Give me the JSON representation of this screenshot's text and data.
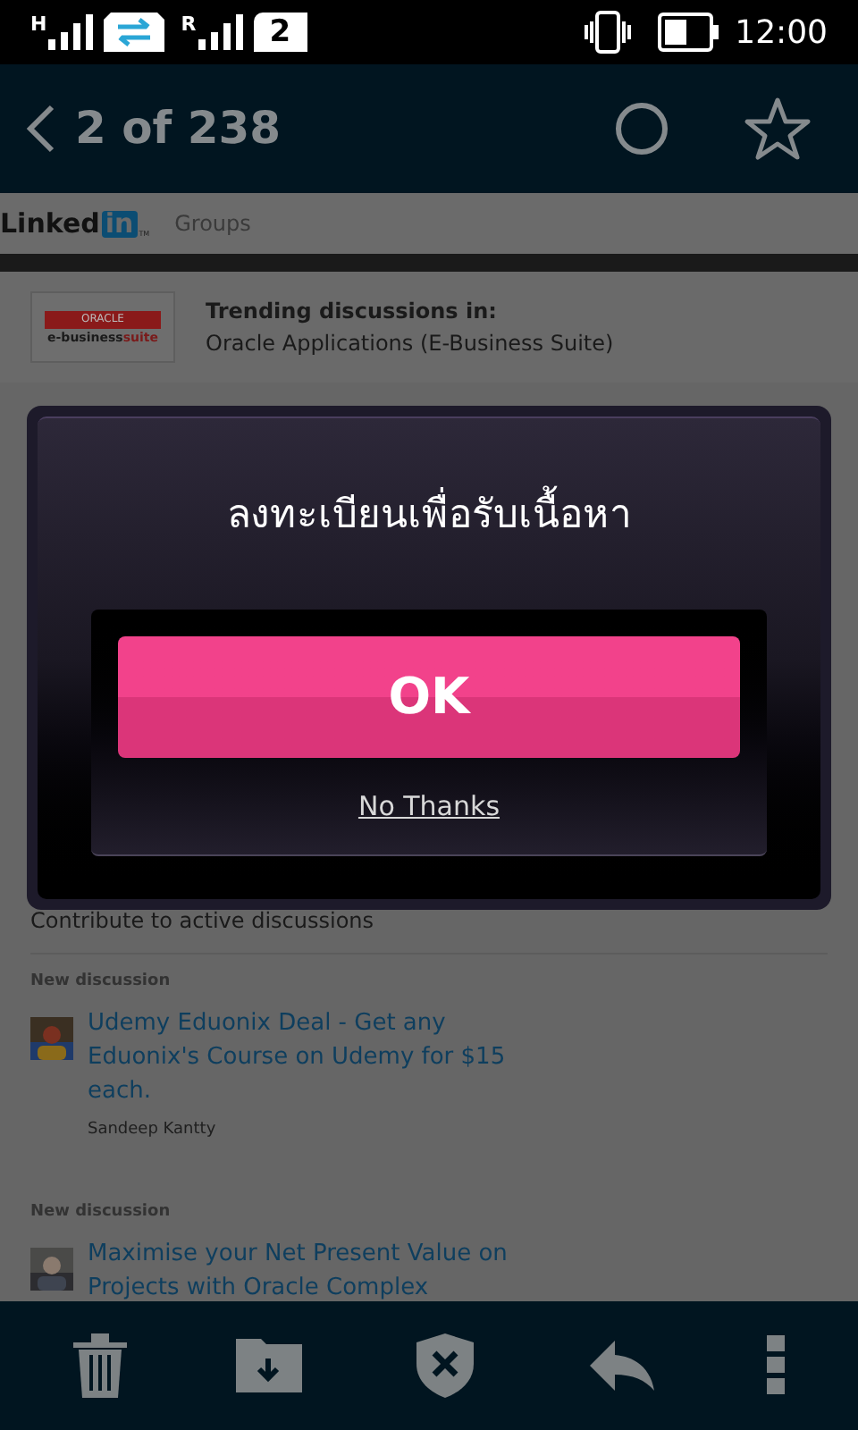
{
  "status_bar": {
    "network_1": "H",
    "network_2": "R",
    "sim": "2",
    "time": "12:00"
  },
  "header": {
    "counter": "2 of 238"
  },
  "email": {
    "logo": {
      "word": "Linked",
      "badge": "in",
      "mark": "TM"
    },
    "section": "Groups",
    "group_logo": {
      "brand": "ORACLE",
      "product_1": "e-business",
      "product_2": "suite"
    },
    "trending_label": "Trending discussions in:",
    "group_name": "Oracle Applications (E-Business Suite)",
    "section_title": "Contribute to active discussions",
    "discussions": [
      {
        "label": "New discussion",
        "title": "Udemy Eduonix Deal - Get any Eduonix's Course on Udemy for $15 each.",
        "author": "Sandeep Kantty"
      },
      {
        "label": "New discussion",
        "title": "Maximise your Net Present Value on Projects with Oracle Complex"
      }
    ]
  },
  "dialog": {
    "title": "ลงทะเบียนเพื่อรับเนื้อหา",
    "ok": "OK",
    "no_thanks": "No Thanks"
  }
}
